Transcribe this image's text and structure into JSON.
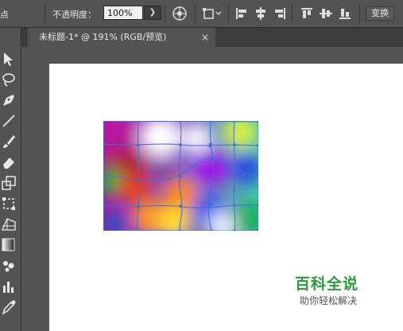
{
  "top_bar": {
    "partial_label": "点",
    "opacity_label": "不透明度：",
    "opacity_value": "100%",
    "transform_label": "变换"
  },
  "document_tab": {
    "title": "未标题-1* @ 191% (RGB/预览)",
    "close_glyph": "×"
  },
  "watermark": {
    "title": "百科全说",
    "subtitle": "助你轻松解决"
  },
  "icons": {
    "globe": "globe-icon",
    "transform_each": "transform-each-icon",
    "align": [
      "align-left-icon",
      "align-horizontal-center-icon",
      "align-right-icon",
      "align-top-icon",
      "align-vertical-center-icon",
      "align-bottom-icon"
    ],
    "tools": [
      "selection-tool-icon",
      "lasso-tool-icon",
      "pen-tool-icon",
      "line-tool-icon",
      "paintbrush-tool-icon",
      "eraser-tool-icon",
      "scale-tool-icon",
      "free-transform-tool-icon",
      "perspective-grid-tool-icon",
      "gradient-tool-icon",
      "symbol-sprayer-tool-icon",
      "graph-tool-icon",
      "eyedropper-tool-icon"
    ]
  },
  "colors": {
    "panel": "#535353",
    "mesh_grid": "#3a6fd0",
    "watermark_green": "#2c9a3c"
  }
}
